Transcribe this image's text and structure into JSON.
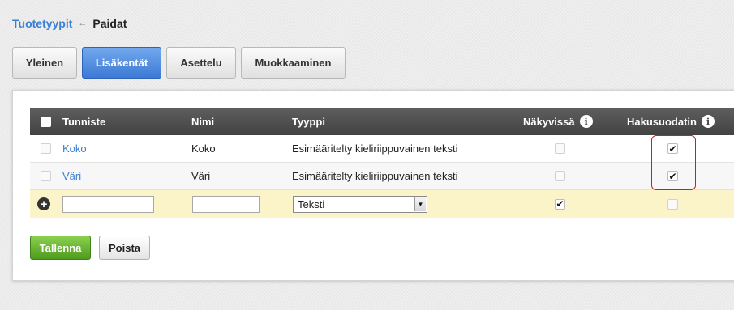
{
  "breadcrumb": {
    "parent": "Tuotetyypit",
    "separator": "←",
    "current": "Paidat"
  },
  "tabs": [
    {
      "label": "Yleinen",
      "active": false
    },
    {
      "label": "Lisäkentät",
      "active": true
    },
    {
      "label": "Asettelu",
      "active": false
    },
    {
      "label": "Muokkaaminen",
      "active": false
    }
  ],
  "table": {
    "columns": {
      "identifier": "Tunniste",
      "name": "Nimi",
      "type": "Tyyppi",
      "visible": "Näkyvissä",
      "search_filter": "Hakusuodatin"
    },
    "rows": [
      {
        "identifier": "Koko",
        "name": "Koko",
        "type": "Esimääritelty kieliriippuvainen teksti",
        "visible": false,
        "search_filter": true
      },
      {
        "identifier": "Väri",
        "name": "Väri",
        "type": "Esimääritelty kieliriippuvainen teksti",
        "visible": false,
        "search_filter": true
      }
    ],
    "new_row": {
      "identifier_value": "",
      "name_value": "",
      "type_selected": "Teksti",
      "visible": true,
      "search_filter": false
    }
  },
  "buttons": {
    "save": "Tallenna",
    "delete": "Poista"
  },
  "icons": {
    "info": "info-icon",
    "add": "plus-icon",
    "check": "✔"
  },
  "colors": {
    "accent": "#3d7ad6",
    "link": "#3b7fd3",
    "save": "#5aa524",
    "highlight": "#d51a1a",
    "new_row_bg": "#fbf4c9"
  }
}
